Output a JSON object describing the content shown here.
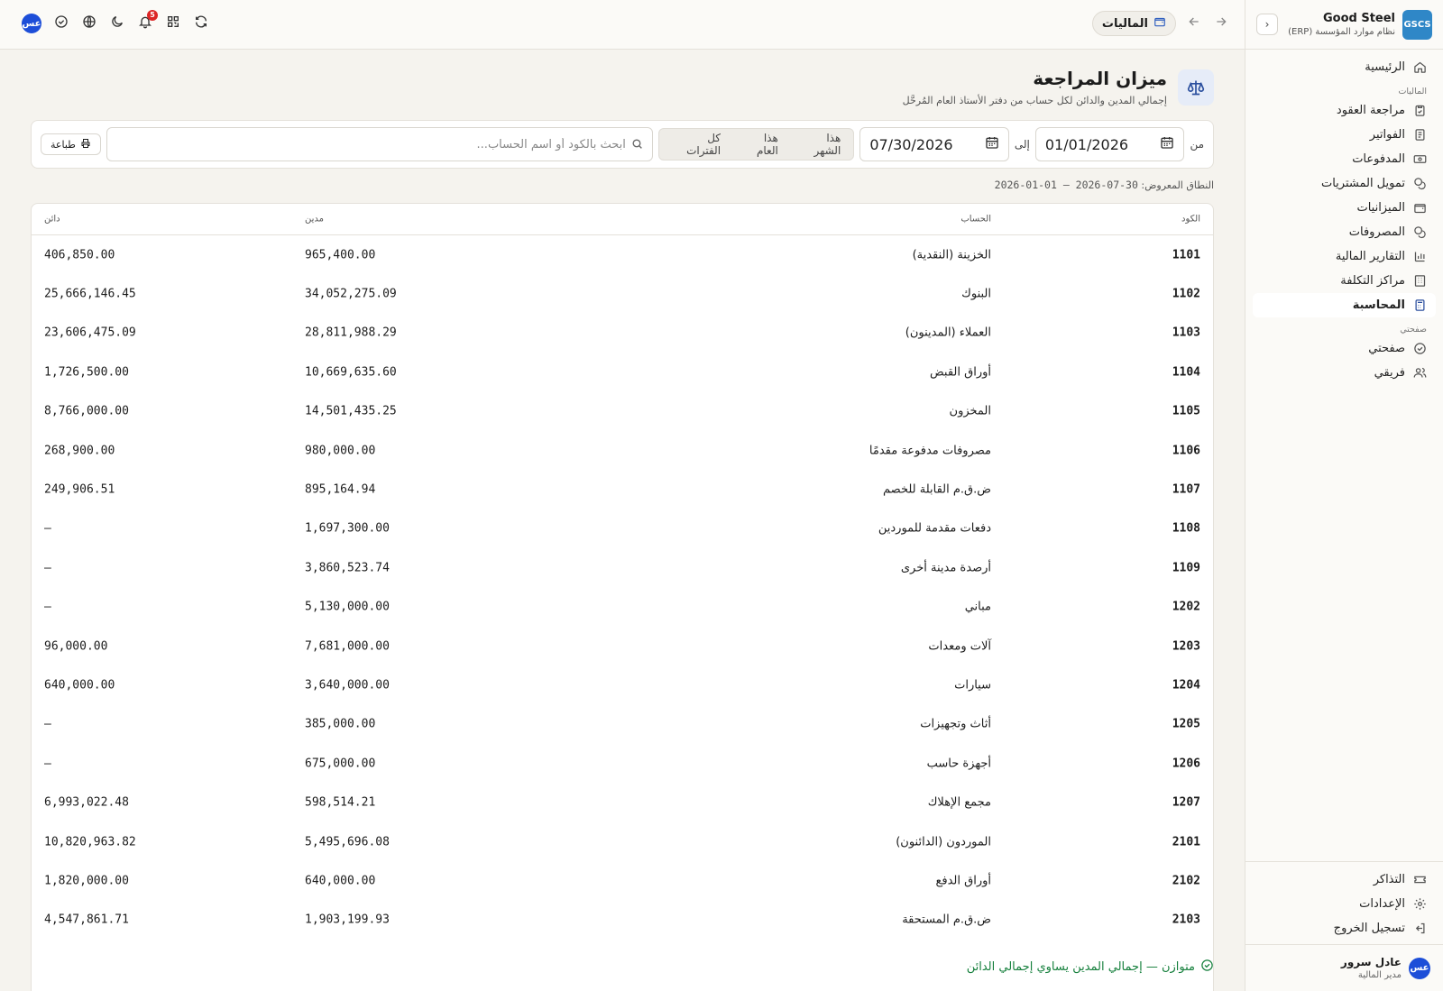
{
  "brand": {
    "logo": "GSCS",
    "name": "Good Steel",
    "subtitle": "نظام موارد المؤسسة (ERP)"
  },
  "sidebar": {
    "home": "الرئيسية",
    "section_finance": "الماليات",
    "items": [
      {
        "label": "مراجعة العقود",
        "icon": "clipboard-check-icon"
      },
      {
        "label": "الفواتير",
        "icon": "receipt-icon"
      },
      {
        "label": "المدفوعات",
        "icon": "banknote-icon"
      },
      {
        "label": "تمويل المشتريات",
        "icon": "coins-icon"
      },
      {
        "label": "الميزانيات",
        "icon": "wallet-icon"
      },
      {
        "label": "المصروفات",
        "icon": "coins-icon"
      },
      {
        "label": "التقارير المالية",
        "icon": "bar-chart-icon"
      },
      {
        "label": "مراكز التكلفة",
        "icon": "building-icon"
      },
      {
        "label": "المحاسبة",
        "icon": "calculator-icon",
        "active": true
      }
    ],
    "section_mine": "صفحتي",
    "mine": [
      {
        "label": "صفحتي",
        "icon": "check-circle-icon"
      },
      {
        "label": "فريقي",
        "icon": "users-icon"
      }
    ],
    "bottom": [
      {
        "label": "التذاكر",
        "icon": "ticket-icon"
      },
      {
        "label": "الإعدادات",
        "icon": "gear-icon"
      },
      {
        "label": "تسجيل الخروج",
        "icon": "logout-icon"
      }
    ],
    "user": {
      "initials": "عس",
      "name": "عادل سرور",
      "role": "مدير المالية"
    }
  },
  "topbar": {
    "module": "الماليات",
    "notifications_count": "5",
    "avatar_initials": "عس"
  },
  "page": {
    "title": "ميزان المراجعة",
    "subtitle": "إجمالي المدين والدائن لكل حساب من دفتر الأستاذ العام المُرحَّل"
  },
  "filters": {
    "from_label": "من",
    "from_date": "01/01/2026",
    "to_label": "إلى",
    "to_date": "07/30/2026",
    "presets": [
      "هذا الشهر",
      "هذا العام",
      "كل الفترات"
    ],
    "search_placeholder": "ابحث بالكود أو اسم الحساب...",
    "print_label": "طباعة"
  },
  "range": {
    "label": "النطاق المعروض:",
    "value": "2026-01-01 — 2026-07-30"
  },
  "table": {
    "headers": {
      "code": "الكود",
      "account": "الحساب",
      "debit": "مدين",
      "credit": "دائن"
    },
    "rows": [
      {
        "code": "1101",
        "account": "الخزينة (النقدية)",
        "debit": "965,400.00",
        "credit": "406,850.00"
      },
      {
        "code": "1102",
        "account": "البنوك",
        "debit": "34,052,275.09",
        "credit": "25,666,146.45"
      },
      {
        "code": "1103",
        "account": "العملاء (المدينون)",
        "debit": "28,811,988.29",
        "credit": "23,606,475.09"
      },
      {
        "code": "1104",
        "account": "أوراق القبض",
        "debit": "10,669,635.60",
        "credit": "1,726,500.00"
      },
      {
        "code": "1105",
        "account": "المخزون",
        "debit": "14,501,435.25",
        "credit": "8,766,000.00"
      },
      {
        "code": "1106",
        "account": "مصروفات مدفوعة مقدمًا",
        "debit": "980,000.00",
        "credit": "268,900.00"
      },
      {
        "code": "1107",
        "account": "ض.ق.م القابلة للخصم",
        "debit": "895,164.94",
        "credit": "249,906.51"
      },
      {
        "code": "1108",
        "account": "دفعات مقدمة للموردين",
        "debit": "1,697,300.00",
        "credit": "—"
      },
      {
        "code": "1109",
        "account": "أرصدة مدينة أخرى",
        "debit": "3,860,523.74",
        "credit": "—"
      },
      {
        "code": "1202",
        "account": "مباني",
        "debit": "5,130,000.00",
        "credit": "—"
      },
      {
        "code": "1203",
        "account": "آلات ومعدات",
        "debit": "7,681,000.00",
        "credit": "96,000.00"
      },
      {
        "code": "1204",
        "account": "سيارات",
        "debit": "3,640,000.00",
        "credit": "640,000.00"
      },
      {
        "code": "1205",
        "account": "أثاث وتجهيزات",
        "debit": "385,000.00",
        "credit": "—"
      },
      {
        "code": "1206",
        "account": "أجهزة حاسب",
        "debit": "675,000.00",
        "credit": "—"
      },
      {
        "code": "1207",
        "account": "مجمع الإهلاك",
        "debit": "598,514.21",
        "credit": "6,993,022.48"
      },
      {
        "code": "2101",
        "account": "الموردون (الدائنون)",
        "debit": "5,495,696.08",
        "credit": "10,820,963.82"
      },
      {
        "code": "2102",
        "account": "أوراق الدفع",
        "debit": "640,000.00",
        "credit": "1,820,000.00"
      },
      {
        "code": "2103",
        "account": "ض.ق.م المستحقة",
        "debit": "1,903,199.93",
        "credit": "4,547,861.71"
      }
    ]
  },
  "status": {
    "balanced_text": "متوازن — إجمالي المدين يساوي إجمالي الدائن",
    "color": "#16803d"
  }
}
